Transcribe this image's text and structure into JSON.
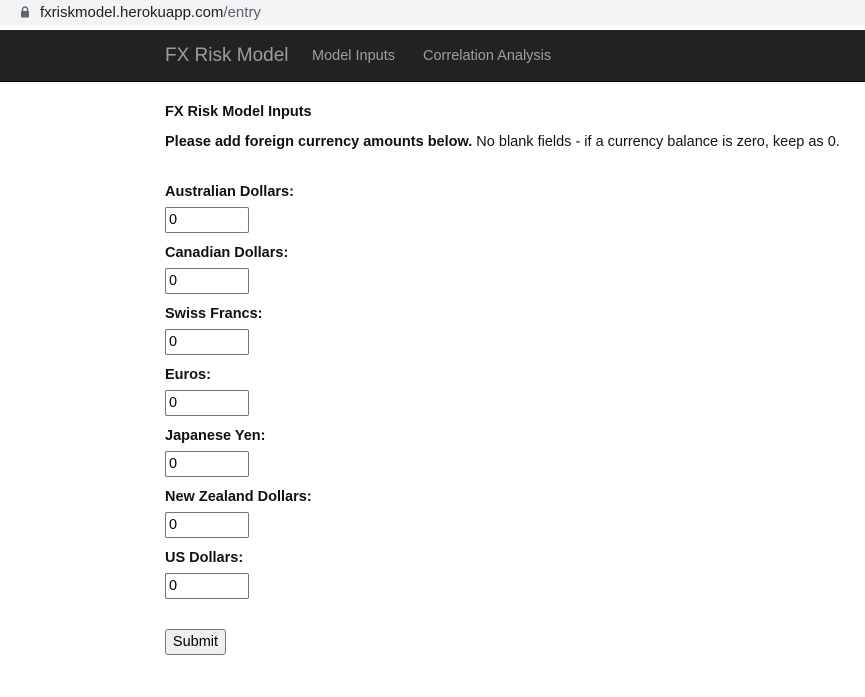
{
  "browser": {
    "url_host": "fxriskmodel.herokuapp.com",
    "url_path": "/entry"
  },
  "navbar": {
    "brand": "FX Risk Model",
    "links": [
      {
        "label": "Model Inputs"
      },
      {
        "label": "Correlation Analysis"
      }
    ]
  },
  "form": {
    "heading": "FX Risk Model Inputs",
    "instructions_bold": "Please add foreign currency amounts below.",
    "instructions_rest": " No blank fields - if a currency balance is zero, keep as 0.",
    "fields": [
      {
        "label": "Australian Dollars:",
        "value": "0"
      },
      {
        "label": "Canadian Dollars:",
        "value": "0"
      },
      {
        "label": "Swiss Francs:",
        "value": "0"
      },
      {
        "label": "Euros:",
        "value": "0"
      },
      {
        "label": "Japanese Yen:",
        "value": "0"
      },
      {
        "label": "New Zealand Dollars:",
        "value": "0"
      },
      {
        "label": "US Dollars:",
        "value": "0"
      }
    ],
    "submit_label": "Submit"
  }
}
